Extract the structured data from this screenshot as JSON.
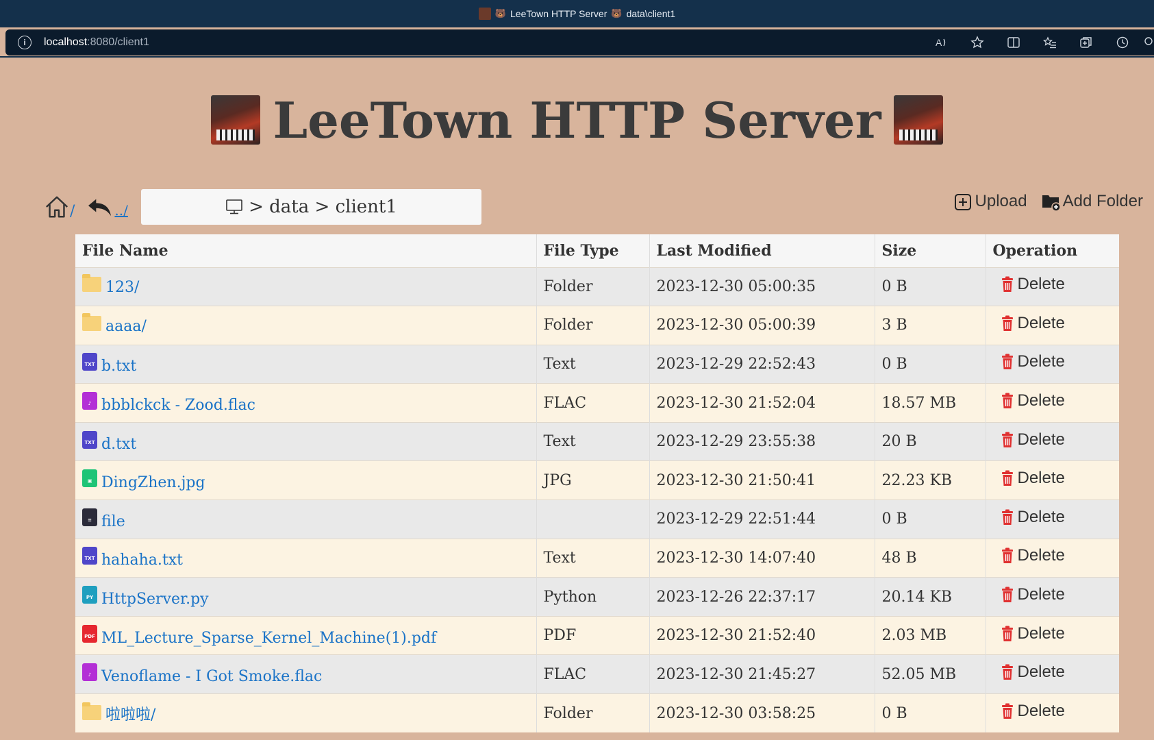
{
  "browser": {
    "tab_title_prefix": "LeeTown HTTP Server",
    "tab_title_suffix": "data\\client1",
    "url_host": "localhost",
    "url_rest": ":8080/client1"
  },
  "header": {
    "title": "LeeTown HTTP Server"
  },
  "nav": {
    "home_label": "/",
    "back_label": "../"
  },
  "breadcrumb": {
    "path": "> data > client1"
  },
  "actions": {
    "upload_label": "Upload",
    "add_folder_label": "Add Folder"
  },
  "table": {
    "headers": [
      "File Name",
      "File Type",
      "Last Modified",
      "Size",
      "Operation"
    ],
    "delete_label": "Delete",
    "rows": [
      {
        "name": "123/",
        "type": "Folder",
        "modified": "2023-12-30 05:00:35",
        "size": "0 B",
        "icon": "folder-icon"
      },
      {
        "name": "aaaa/",
        "type": "Folder",
        "modified": "2023-12-30 05:00:39",
        "size": "3 B",
        "icon": "folder-icon"
      },
      {
        "name": "b.txt",
        "type": "Text",
        "modified": "2023-12-29 22:52:43",
        "size": "0 B",
        "icon": "txt-file-icon"
      },
      {
        "name": "bbblckck - Zood.flac",
        "type": "FLAC",
        "modified": "2023-12-30 21:52:04",
        "size": "18.57 MB",
        "icon": "audio-file-icon"
      },
      {
        "name": "d.txt",
        "type": "Text",
        "modified": "2023-12-29 23:55:38",
        "size": "20 B",
        "icon": "txt-file-icon"
      },
      {
        "name": "DingZhen.jpg",
        "type": "JPG",
        "modified": "2023-12-30 21:50:41",
        "size": "22.23 KB",
        "icon": "image-file-icon"
      },
      {
        "name": "file",
        "type": "",
        "modified": "2023-12-29 22:51:44",
        "size": "0 B",
        "icon": "generic-file-icon"
      },
      {
        "name": "hahaha.txt",
        "type": "Text",
        "modified": "2023-12-30 14:07:40",
        "size": "48 B",
        "icon": "txt-file-icon"
      },
      {
        "name": "HttpServer.py",
        "type": "Python",
        "modified": "2023-12-26 22:37:17",
        "size": "20.14 KB",
        "icon": "python-file-icon"
      },
      {
        "name": "ML_Lecture_Sparse_Kernel_Machine(1).pdf",
        "type": "PDF",
        "modified": "2023-12-30 21:52:40",
        "size": "2.03 MB",
        "icon": "pdf-file-icon"
      },
      {
        "name": "Venoflame - I Got Smoke.flac",
        "type": "FLAC",
        "modified": "2023-12-30 21:45:27",
        "size": "52.05 MB",
        "icon": "audio-file-icon"
      },
      {
        "name": "啦啦啦/",
        "type": "Folder",
        "modified": "2023-12-30 03:58:25",
        "size": "0 B",
        "icon": "folder-icon"
      }
    ]
  },
  "colors": {
    "page_bg": "#d8b49c",
    "link": "#1a73c7",
    "delete_icon": "#e03131",
    "row_odd": "#e9e9e9",
    "row_even": "#fcf3e2"
  }
}
